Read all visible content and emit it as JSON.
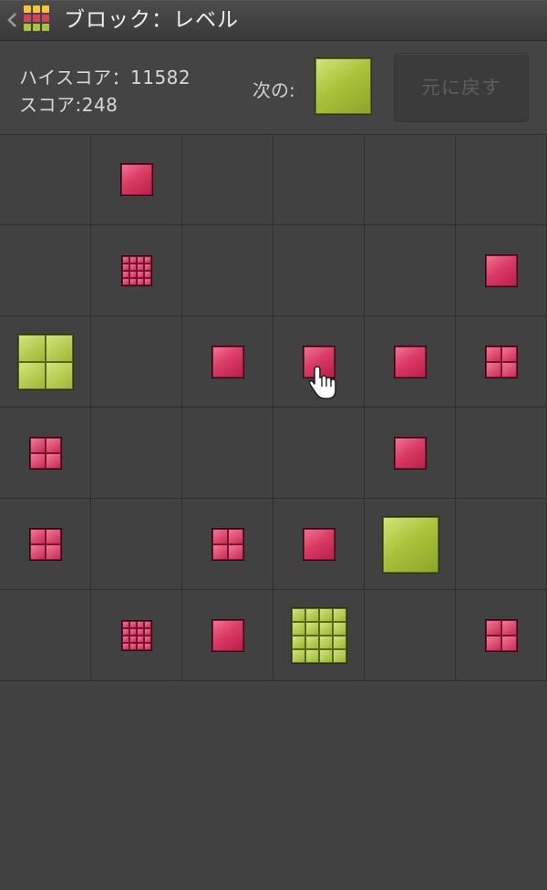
{
  "header": {
    "title": "ブロック：レベル",
    "icon": "block-grid-app-icon",
    "back_icon": "chevron-left-icon"
  },
  "score_panel": {
    "high_score": "ハイスコア：11582",
    "score": "スコア:248",
    "next_label": "次の:",
    "next_block": {
      "color": "green",
      "level": 1
    },
    "undo_label": "元に戻す"
  },
  "colors": {
    "pink": "#db3b66",
    "green": "#a9c43b",
    "background": "#414141"
  },
  "board": {
    "columns": 6,
    "rows": 6,
    "cells": [
      [
        null,
        {
          "color": "pink",
          "level": 1
        },
        null,
        null,
        null,
        null
      ],
      [
        null,
        {
          "color": "pink",
          "level": 3
        },
        null,
        null,
        null,
        {
          "color": "pink",
          "level": 1
        }
      ],
      [
        {
          "color": "green",
          "level": 2
        },
        null,
        {
          "color": "pink",
          "level": 1
        },
        {
          "color": "pink",
          "level": 1
        },
        {
          "color": "pink",
          "level": 1
        },
        {
          "color": "pink",
          "level": 2
        }
      ],
      [
        {
          "color": "pink",
          "level": 2
        },
        null,
        null,
        null,
        {
          "color": "pink",
          "level": 1
        },
        null
      ],
      [
        {
          "color": "pink",
          "level": 2
        },
        null,
        {
          "color": "pink",
          "level": 2
        },
        {
          "color": "pink",
          "level": 1
        },
        {
          "color": "green",
          "level": 1
        },
        null
      ],
      [
        null,
        {
          "color": "pink",
          "level": 3
        },
        {
          "color": "pink",
          "level": 1
        },
        {
          "color": "green",
          "level": 3
        },
        null,
        {
          "color": "pink",
          "level": 2
        }
      ]
    ],
    "cursor": {
      "row": 2,
      "col": 3,
      "icon": "hand-pointer-icon"
    }
  }
}
